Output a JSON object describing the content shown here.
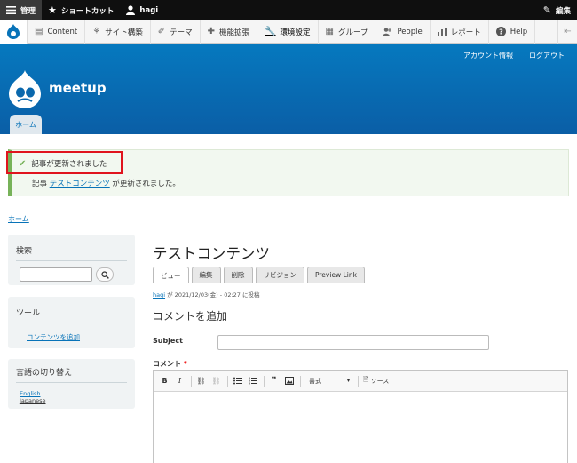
{
  "admin_bar": {
    "manage_label": "管理",
    "shortcuts_label": "ショートカット",
    "user_label": "hagi",
    "edit_label": "編集"
  },
  "admin_menu": {
    "items": [
      {
        "label": "Content",
        "icon": "content-icon"
      },
      {
        "label": "サイト構築",
        "icon": "structure-icon"
      },
      {
        "label": "テーマ",
        "icon": "appearance-icon"
      },
      {
        "label": "機能拡張",
        "icon": "extend-icon"
      },
      {
        "label": "環境設定",
        "icon": "config-icon"
      },
      {
        "label": "グループ",
        "icon": "group-icon"
      },
      {
        "label": "People",
        "icon": "people-icon"
      },
      {
        "label": "レポート",
        "icon": "reports-icon"
      },
      {
        "label": "Help",
        "icon": "help-icon"
      }
    ]
  },
  "header": {
    "account_link": "アカウント情報",
    "logout_link": "ログアウト",
    "site_name": "meetup",
    "home_tab": "ホーム"
  },
  "messages": {
    "title": "記事が更新されました",
    "body_prefix": "記事 ",
    "body_link": "テストコンテンツ",
    "body_suffix": " が更新されました。"
  },
  "breadcrumb": "ホーム",
  "sidebar": {
    "search_title": "検索",
    "tools_title": "ツール",
    "tools_link": "コンテンツを追加",
    "language_title": "言語の切り替え",
    "languages": [
      "English",
      "Japanese"
    ]
  },
  "node": {
    "title": "テストコンテンツ",
    "tabs": [
      "ビュー",
      "編集",
      "削除",
      "リビジョン",
      "Preview Link"
    ],
    "author": "hagi",
    "submitted_text": " が 2021/12/03(金) - 02:27 に投稿"
  },
  "comment_form": {
    "heading": "コメントを追加",
    "subject_label": "Subject",
    "comment_label": "コメント",
    "required_mark": "*",
    "format_label": "書式",
    "source_label": "ソース"
  },
  "colors": {
    "admin_bar": "#0f0f0f",
    "header_blue": "#0679bf",
    "link": "#0873b8",
    "status_green": "#77b259",
    "highlight_red": "#e0141e"
  }
}
